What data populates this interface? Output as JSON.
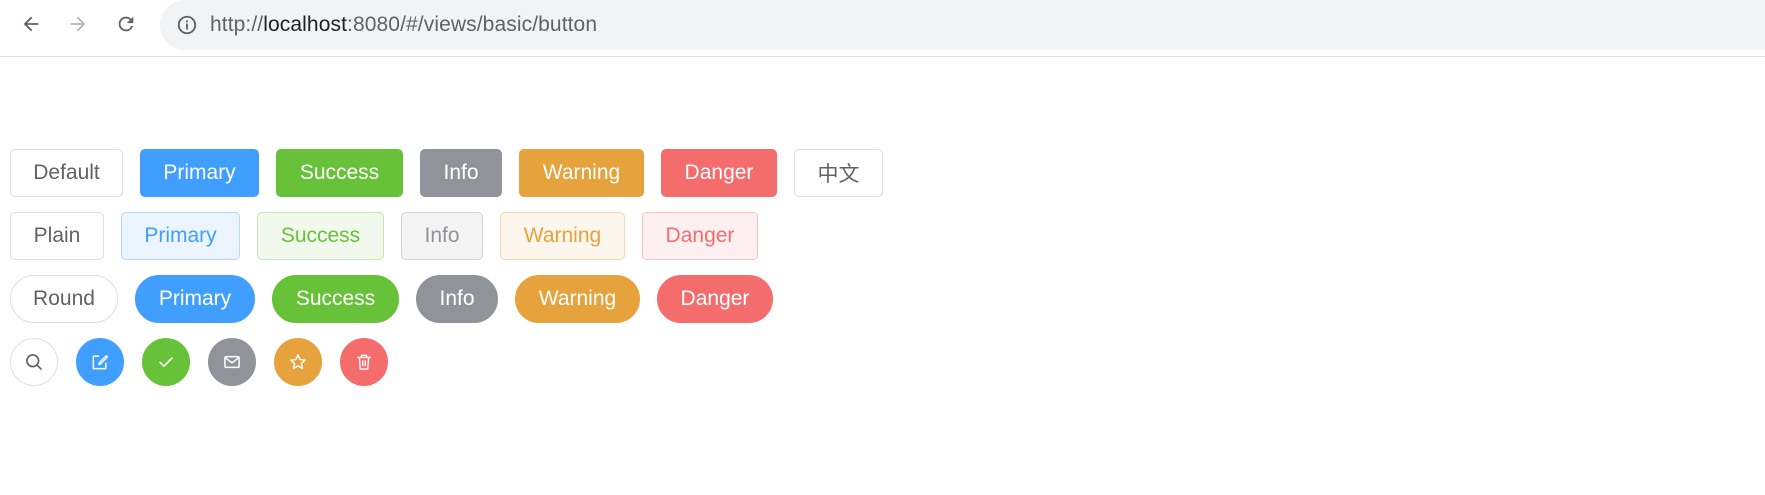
{
  "browser": {
    "url_prefix": "http://",
    "url_host": "localhost",
    "url_rest": ":8080/#/views/basic/button",
    "icons": {
      "back": "arrow-left-icon",
      "forward": "arrow-right-icon",
      "reload": "reload-icon",
      "info": "info-icon"
    }
  },
  "rows": {
    "default": [
      "Default",
      "Primary",
      "Success",
      "Info",
      "Warning",
      "Danger",
      "中文"
    ],
    "plain": [
      "Plain",
      "Primary",
      "Success",
      "Info",
      "Warning",
      "Danger"
    ],
    "round": [
      "Round",
      "Primary",
      "Success",
      "Info",
      "Warning",
      "Danger"
    ],
    "circle_icons": [
      "search-icon",
      "edit-icon",
      "check-icon",
      "message-icon",
      "star-icon",
      "delete-icon"
    ]
  },
  "colors": {
    "primary": "#409eff",
    "success": "#67c23a",
    "info": "#909399",
    "warning": "#e6a23c",
    "danger": "#f56c6c",
    "default_text": "#606266",
    "border": "#dcdfe6"
  }
}
